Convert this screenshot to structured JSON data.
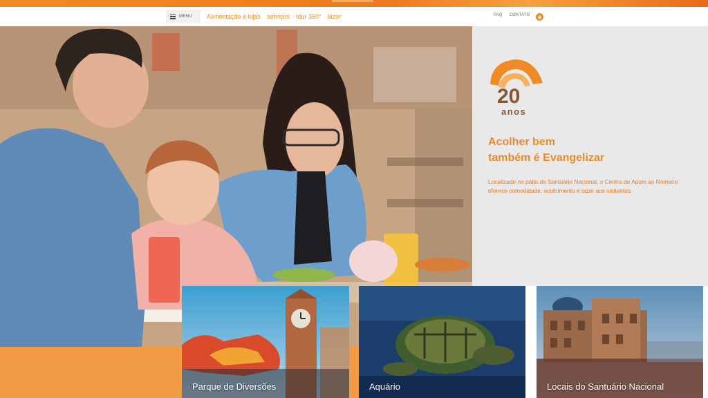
{
  "nav": {
    "menu_label": "MENU",
    "links": [
      "Alimentação e lojas",
      "serviços",
      "tour 360°",
      "lazer"
    ],
    "faq": "FAQ",
    "contact": "CONTATO",
    "rss_icon": "rss-icon"
  },
  "hero": {
    "logo_number": "20",
    "logo_word": "anos",
    "slogan_line1": "Acolher bem",
    "slogan_line2": "também é Evangelizar",
    "description": "Localizado no pátio do Santuário Nacional, o Centro de Apoio ao Romeiro oferece comodidade, acolhimento e lazer aos visitantes."
  },
  "cards": [
    {
      "caption": "Parque de Diversões"
    },
    {
      "caption": "Aquário"
    },
    {
      "caption": "Locais do Santuário Nacional"
    }
  ],
  "colors": {
    "brand_orange": "#e88a2a",
    "panel_bg": "#e9e9e9",
    "accent_orange": "#f39a45"
  }
}
